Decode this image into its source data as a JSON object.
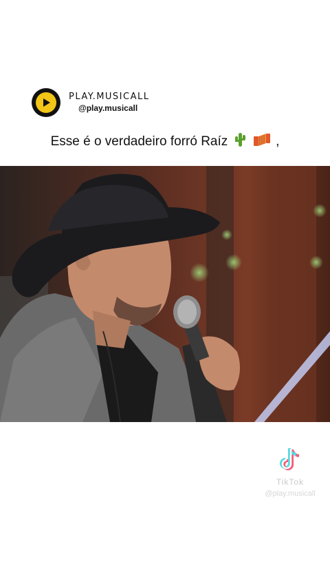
{
  "header": {
    "brand_name": "PLAY.MUSICALL",
    "handle": "@play.musicall",
    "logo_icon": "play-icon",
    "logo_colors": {
      "outer": "#111111",
      "inner": "#f2c516"
    }
  },
  "caption": {
    "text": "Esse é o verdadeiro forró Raíz",
    "trailing": ",",
    "emojis": [
      "cactus-icon",
      "accordion-icon"
    ]
  },
  "video": {
    "description_icon": "video-frame"
  },
  "watermark": {
    "app": "TikTok",
    "handle": "@play.musicall"
  }
}
